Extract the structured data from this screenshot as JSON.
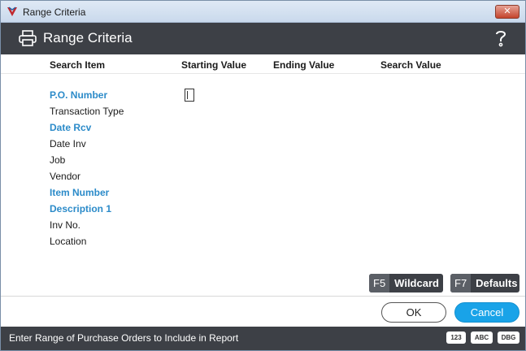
{
  "window": {
    "title": "Range Criteria"
  },
  "header": {
    "title": "Range Criteria",
    "print_icon": "printer-icon",
    "help_icon": "question-mark-icon"
  },
  "columns": {
    "search_item": "Search Item",
    "starting_value": "Starting Value",
    "ending_value": "Ending Value",
    "search_value": "Search Value"
  },
  "rows": [
    {
      "label": "P.O. Number",
      "active": true
    },
    {
      "label": "Transaction Type",
      "active": false
    },
    {
      "label": "Date Rcv",
      "active": true
    },
    {
      "label": "Date Inv",
      "active": false
    },
    {
      "label": "Job",
      "active": false
    },
    {
      "label": "Vendor",
      "active": false
    },
    {
      "label": "Item Number",
      "active": true
    },
    {
      "label": "Description 1",
      "active": true
    },
    {
      "label": "Inv No.",
      "active": false
    },
    {
      "label": "Location",
      "active": false
    }
  ],
  "function_keys": {
    "wildcard": {
      "key": "F5",
      "label": "Wildcard"
    },
    "defaults": {
      "key": "F7",
      "label": "Defaults"
    }
  },
  "buttons": {
    "ok": "OK",
    "cancel": "Cancel"
  },
  "status": {
    "text": "Enter Range of Purchase Orders to Include in Report",
    "badges": [
      "123",
      "ABC",
      "DBG"
    ]
  },
  "colors": {
    "header_bg": "#3d4046",
    "accent_blue": "#2c8bc9",
    "cancel_blue": "#19a3e8"
  }
}
